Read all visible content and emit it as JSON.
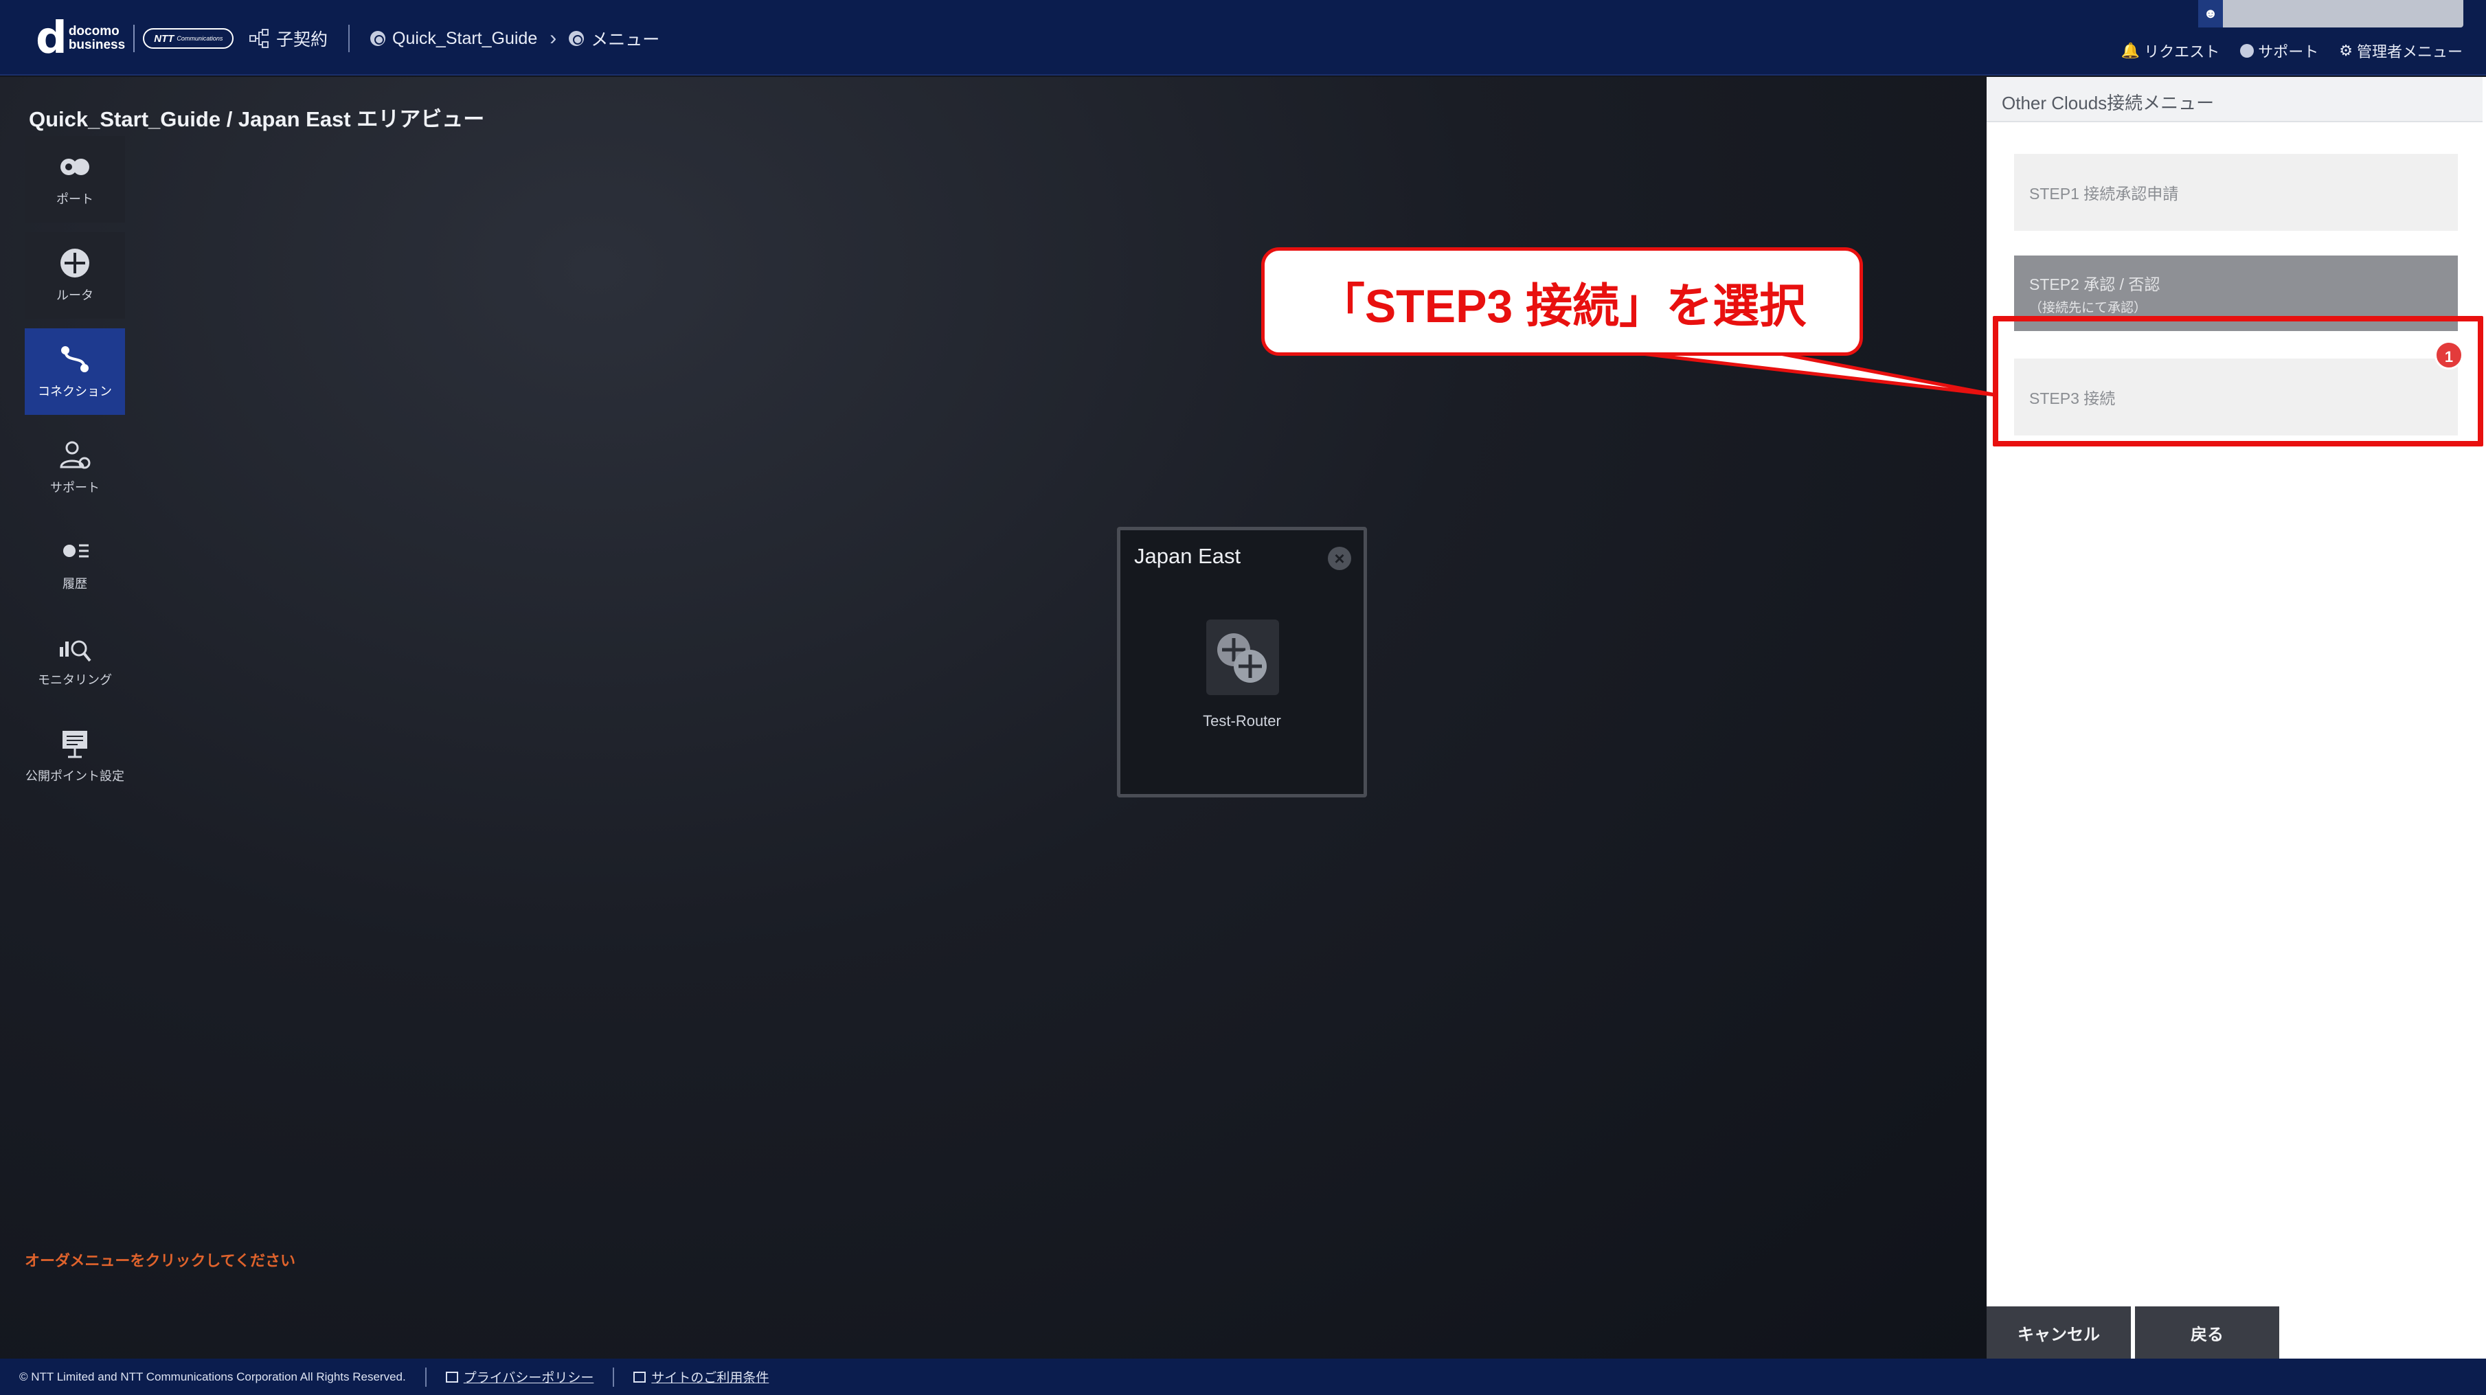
{
  "header": {
    "logo_main": "d",
    "logo_line1": "docomo",
    "logo_line2": "business",
    "ntt_logo": "NTT",
    "ntt_logo_small": "Communications",
    "breadcrumbs": [
      "子契約",
      "Quick_Start_Guide",
      "メニュー"
    ],
    "links": {
      "request": "リクエスト",
      "support": "サポート",
      "admin_menu": "管理者メニュー"
    }
  },
  "canvas": {
    "page_title": "Quick_Start_Guide / Japan East エリアビュー",
    "nav": [
      {
        "label": "ポート",
        "icon": "port-icon"
      },
      {
        "label": "ルータ",
        "icon": "router-icon"
      },
      {
        "label": "コネクション",
        "icon": "connection-icon",
        "active": true
      },
      {
        "label": "サポート",
        "icon": "support-icon"
      },
      {
        "label": "履歴",
        "icon": "history-icon"
      },
      {
        "label": "モニタリング",
        "icon": "monitoring-icon"
      },
      {
        "label": "公開ポイント設定",
        "icon": "public-point-icon"
      }
    ],
    "region_card": {
      "title": "Japan East",
      "router_label": "Test-Router"
    },
    "order_message": "オーダメニューをクリックしてください"
  },
  "right_panel": {
    "title": "Other Clouds接続メニュー",
    "steps": [
      {
        "label": "STEP1 接続承認申請"
      },
      {
        "label": "STEP2 承認 / 否認",
        "sub": "（接続先にて承認）"
      },
      {
        "label": "STEP3 接続"
      }
    ],
    "buttons": {
      "cancel": "キャンセル",
      "back": "戻る"
    }
  },
  "annotation": {
    "callout_text": "「STEP3 接続」を選択",
    "badge": "1",
    "color": "#e8100f"
  },
  "footer": {
    "copyright": "© NTT Limited and NTT Communications Corporation All Rights Reserved.",
    "privacy": "プライバシーポリシー",
    "terms": "サイトのご利用条件"
  }
}
